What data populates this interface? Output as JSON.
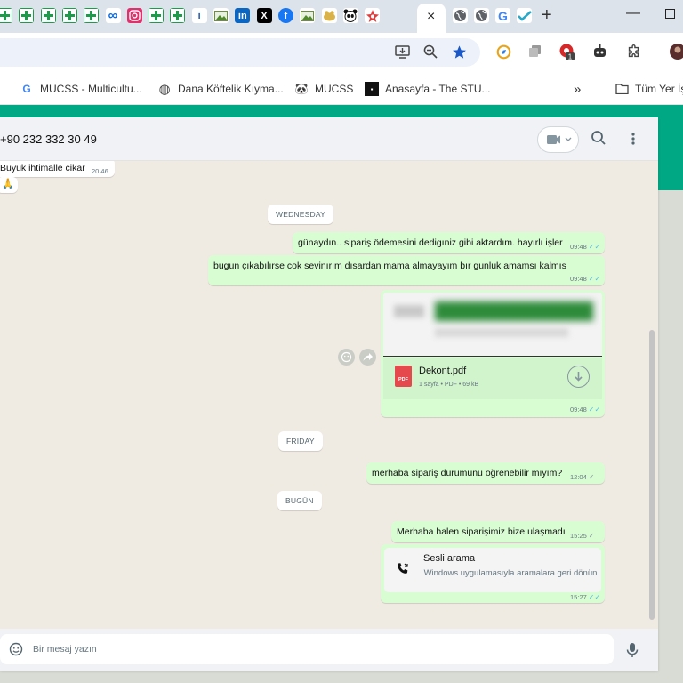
{
  "browser": {
    "active_tab_close": "×",
    "new_tab": "+",
    "window_minimize": "—",
    "tab_favicons": [
      "green-plus",
      "green-plus",
      "green-plus",
      "green-plus",
      "green-plus",
      "meta",
      "instagram",
      "green-plus",
      "green-plus",
      "info",
      "gallery",
      "linkedin",
      "x",
      "facebook",
      "gallery",
      "frog",
      "panda",
      "spark",
      "globe",
      "globe",
      "google",
      "checkmark"
    ],
    "tab_favicon_texts": {
      "linkedin": "in",
      "x": "X",
      "facebook": "f",
      "google": "G",
      "meta": "∞",
      "info": "i"
    }
  },
  "bookmarks": {
    "items": [
      {
        "icon": "google-icon",
        "glyph": "G",
        "label": "MUCSS - Multicultu..."
      },
      {
        "icon": "globe-icon",
        "glyph": "◍",
        "label": "Dana Köftelik Kıyma..."
      },
      {
        "icon": "panda-icon",
        "glyph": "🐼",
        "label": "MUCSS"
      },
      {
        "icon": "stu-icon",
        "glyph": "▪",
        "label": "Anasayfa - The STU..."
      }
    ],
    "overflow": "»",
    "all_bookmarks": "Tüm Yer İş"
  },
  "chat": {
    "contact": "+90 232 332 30 49",
    "composer_placeholder": "Bir mesaj yazın",
    "messages": {
      "m1": {
        "text": "Buyuk ihtimalle cikar",
        "time": "20:46"
      },
      "m1_reaction": "🙏",
      "date1": "WEDNESDAY",
      "m2": {
        "text": "günaydın.. sipariş ödemesini dedigıniz gibi aktardım. hayırlı işler",
        "time": "09:48"
      },
      "m3": {
        "text": "bugun çıkabılırse cok sevinırım dısardan mama almayayım bır gunluk amamsı kalmıs",
        "time": "09:48"
      },
      "m4": {
        "file_name": "Dekont.pdf",
        "file_meta": "1 sayfa • PDF • 69 kB",
        "file_type": "PDF",
        "time": "09:48"
      },
      "date2": "FRIDAY",
      "m5": {
        "text": "merhaba sipariş durumunu öğrenebilir mıyım?",
        "time": "12:04"
      },
      "date3": "BUGÜN",
      "m6": {
        "text": "Merhaba halen siparişimiz bize ulaşmadı",
        "time": "15:25"
      },
      "m7": {
        "title": "Sesli arama",
        "body": "Windows uygulamasıyla aramalara geri dönün",
        "time": "15:27"
      }
    }
  },
  "colors": {
    "accent": "#00a884",
    "outgoing_bubble": "#d9fdd3",
    "chat_bg": "#efeae2",
    "read_ticks": "#53bdeb"
  }
}
